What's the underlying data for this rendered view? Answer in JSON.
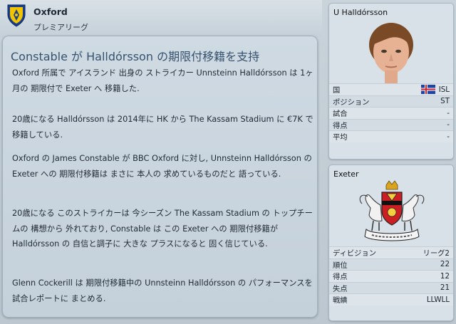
{
  "header": {
    "club_name": "Oxford",
    "league": "プレミアリーグ"
  },
  "news": {
    "title": "Constable が Halldórsson の期限付移籍を支持",
    "paragraphs": [
      "Oxford 所属で アイスランド 出身の ストライカー Unnsteinn Halldórsson は 1ヶ月の 期限付で Exeter へ 移籍した.",
      "20歳になる Halldórsson は 2014年に HK から The Kassam Stadium に €7K で 移籍している.",
      "Oxford の James Constable が BBC Oxford に対し, Unnsteinn Halldórsson の Exeter への 期限付移籍は まさに 本人の 求めているものだと 語っている.",
      "20歳になる このストライカーは 今シーズン The Kassam Stadium の トップチームの 構想から 外れており, Constable は この Exeter への 期限付移籍が Halldórsson の 自信と調子に 大きな プラスになると 固く信じている.",
      "Glenn Cockerill は 期限付移籍中の Unnsteinn Halldórsson の パフォーマンスを 試合レポートに まとめる."
    ]
  },
  "player_card": {
    "name": "U Halldórsson",
    "rows": [
      {
        "label": "国",
        "value": "ISL",
        "flag": "iceland-flag-icon"
      },
      {
        "label": "ポジション",
        "value": "ST"
      },
      {
        "label": "試合",
        "value": "-"
      },
      {
        "label": "得点",
        "value": "-"
      },
      {
        "label": "平均",
        "value": "-"
      }
    ]
  },
  "club_card": {
    "name": "Exeter",
    "rows": [
      {
        "label": "ディビジョン",
        "value": "リーグ2"
      },
      {
        "label": "順位",
        "value": "22"
      },
      {
        "label": "得点",
        "value": "12"
      },
      {
        "label": "失点",
        "value": "21"
      },
      {
        "label": "戦績",
        "value": "LLWLL"
      }
    ]
  },
  "colors": {
    "title": "#35526e",
    "panel_bg": "#cfdae3",
    "badge_blue": "#1b3f8f",
    "badge_yellow": "#f2c500"
  }
}
